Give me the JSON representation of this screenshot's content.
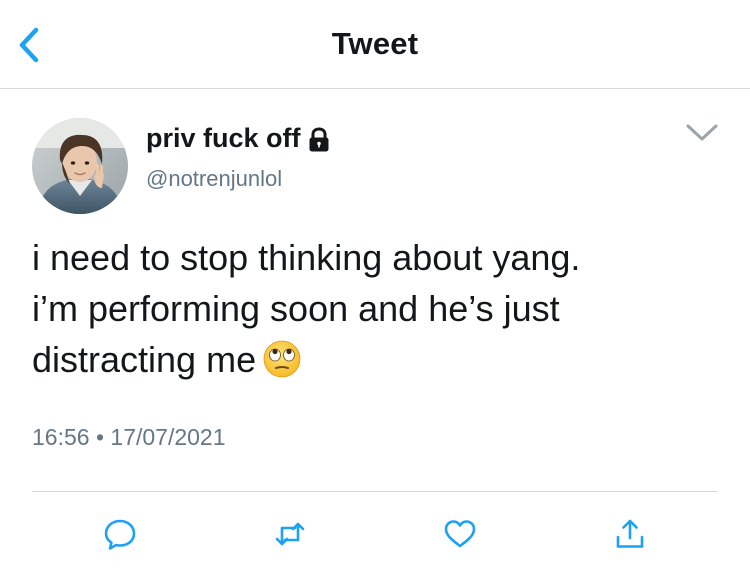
{
  "nav": {
    "title": "Tweet",
    "back_icon": "chevron-left-icon"
  },
  "tweet": {
    "display_name": "priv fuck off",
    "handle": "@notrenjunlol",
    "protected_icon": "lock-icon",
    "more_icon": "chevron-down-icon",
    "text_lines": [
      "i need to stop thinking about yang.",
      "i’m performing soon and he’s just",
      "distracting me"
    ],
    "emoji": "face-with-rolling-eyes",
    "time": "16:56",
    "separator": "•",
    "date": "17/07/2021"
  },
  "actions": {
    "reply_icon": "reply-icon",
    "retweet_icon": "retweet-icon",
    "like_icon": "heart-icon",
    "share_icon": "share-icon"
  },
  "colors": {
    "accent": "#1DA1F2",
    "text": "#14171A",
    "secondary": "#657786",
    "divider": "#D6D9DC"
  }
}
